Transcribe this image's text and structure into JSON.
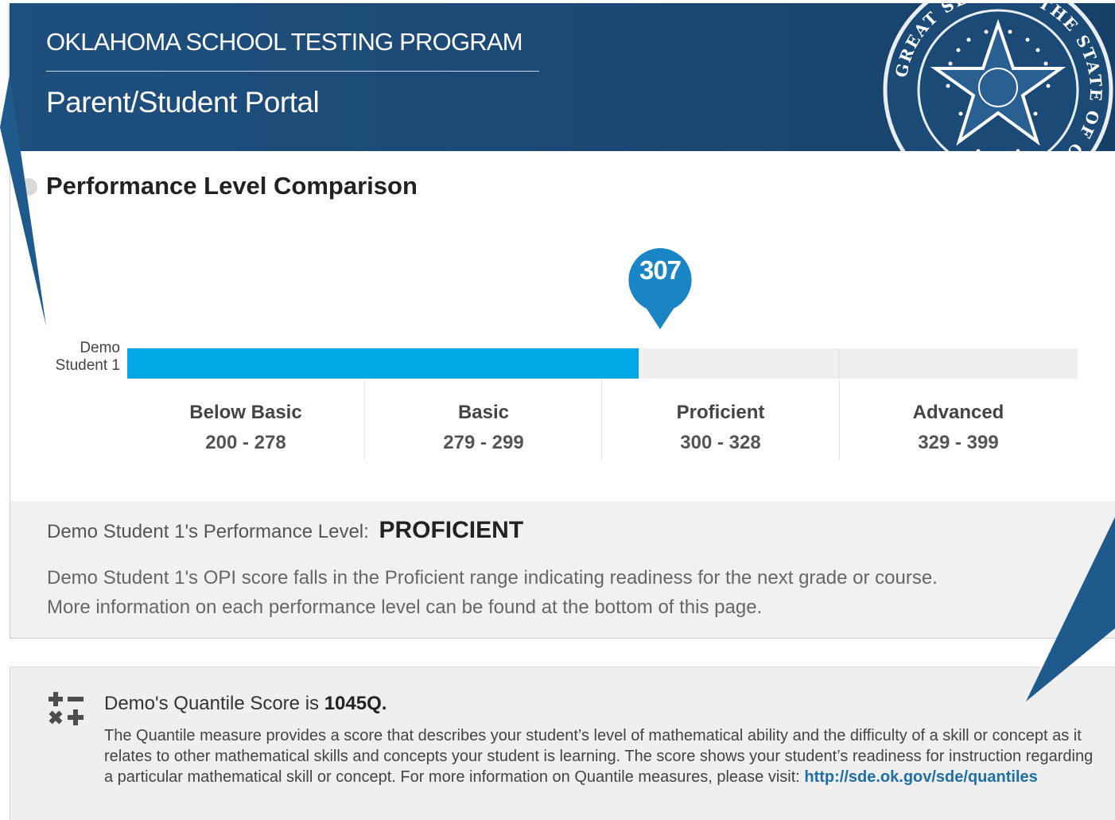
{
  "header": {
    "org_name": "OKLAHOMA SCHOOL TESTING PROGRAM",
    "portal_name": "Parent/Student Portal",
    "seal_text": "GREAT SEAL OF THE STATE OF OKLAHOMA"
  },
  "performance": {
    "section_title": "Performance Level Comparison",
    "student_label_line1": "Demo",
    "student_label_line2": "Student 1",
    "score": "307",
    "score_value": 307,
    "score_min": 200,
    "score_max": 399,
    "bands": [
      {
        "name": "Below Basic",
        "range": "200 - 278"
      },
      {
        "name": "Basic",
        "range": "279 - 299"
      },
      {
        "name": "Proficient",
        "range": "300 - 328"
      },
      {
        "name": "Advanced",
        "range": "329 - 399"
      }
    ],
    "level_label": "Demo Student 1's Performance Level:",
    "level_value": "PROFICIENT",
    "description_line1": "Demo Student 1's OPI score falls in the Proficient range indicating readiness for the next grade or course.",
    "description_line2": "More information on each performance level can be found at the bottom of this page."
  },
  "quantile": {
    "title_prefix": "Demo's Quantile Score is ",
    "score": "1045Q.",
    "text": "The Quantile measure provides a score that describes your student’s level of mathematical ability and the difficulty of a skill or concept as it relates to other mathematical skills and concepts your student is learning. The score shows your student’s readiness for instruction regarding a particular mathematical skill or concept. For more information on Quantile measures, please visit: ",
    "link_text": "http://sde.ok.gov/sde/quantiles"
  },
  "colors": {
    "header_blue": "#1c4a76",
    "bar_fill": "#00a8e6",
    "pin_blue": "#1a85c4",
    "callout_blue": "#1f5a8c",
    "link_blue": "#1e6ea7"
  }
}
